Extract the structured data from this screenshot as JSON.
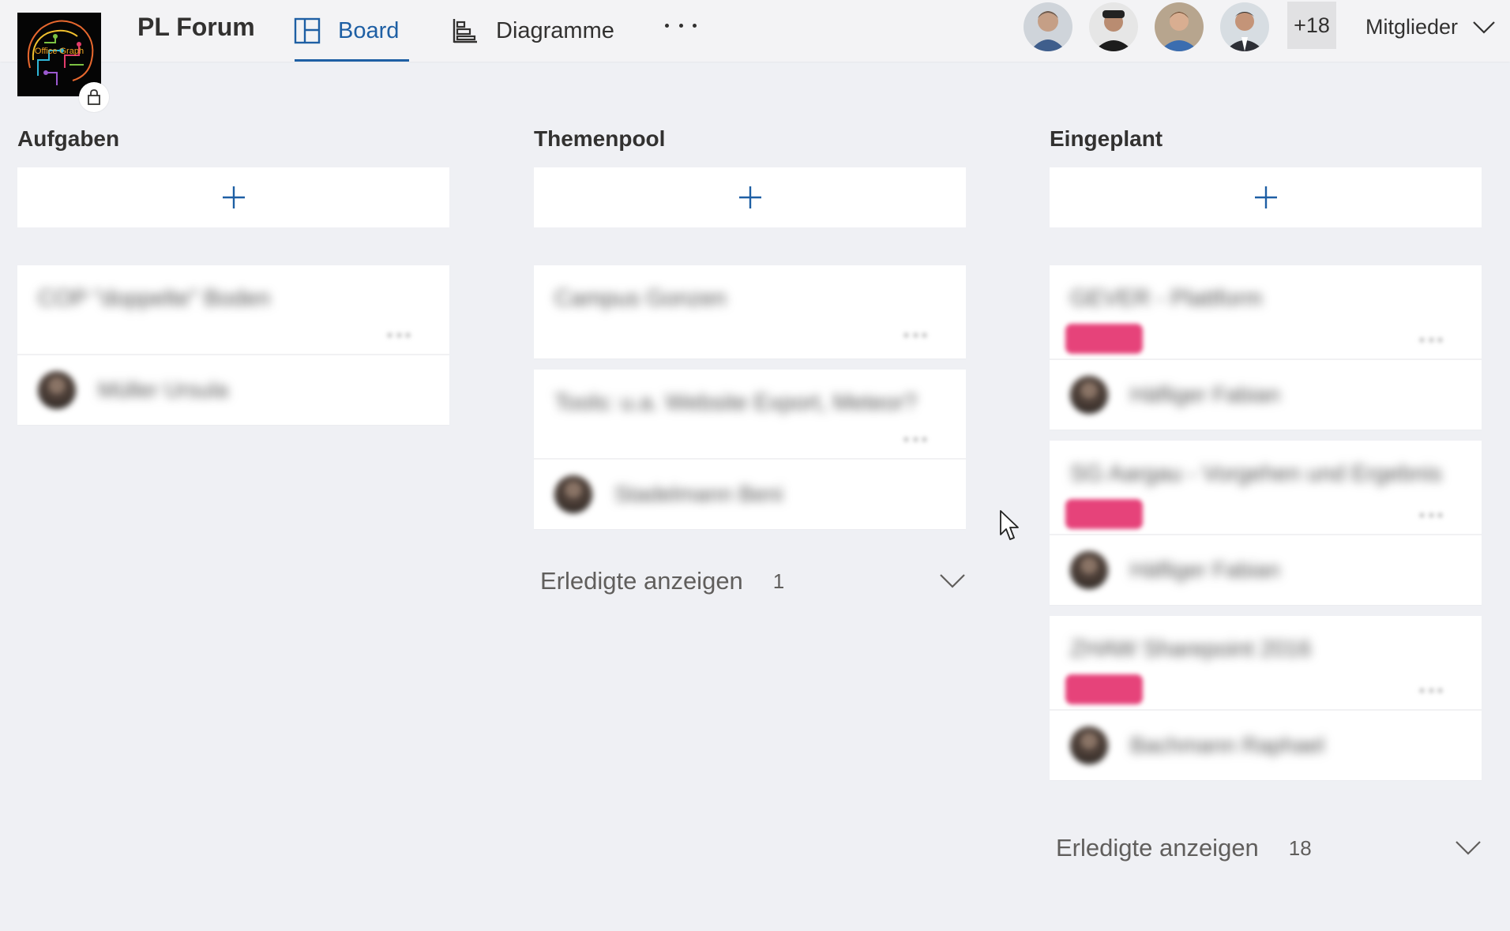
{
  "header": {
    "plan_title": "PL Forum",
    "logo_text": "Office Graph",
    "tabs": [
      {
        "label": "Board",
        "icon": "board-icon",
        "active": true
      },
      {
        "label": "Diagramme",
        "icon": "chart-icon",
        "active": false
      }
    ],
    "more_icon": "ellipsis-icon",
    "members_overflow": "+18",
    "members_label": "Mitglieder",
    "colors": {
      "accent": "#1e5fa4",
      "label_pink": "#e6437a",
      "background": "#eff0f4"
    }
  },
  "columns": [
    {
      "title": "Aufgaben",
      "add_icon": "plus-icon",
      "cards": [
        {
          "title": "COP \"doppelte\" Boden",
          "label": false,
          "assignee": "Müller Ursula"
        }
      ],
      "done": null
    },
    {
      "title": "Themenpool",
      "add_icon": "plus-icon",
      "cards": [
        {
          "title": "Campus Gonzen",
          "label": false,
          "assignee": ""
        },
        {
          "title": "Tools: u.a. Website Export, Meteor?",
          "label": false,
          "assignee": "Stadelmann Beni"
        }
      ],
      "done": {
        "label": "Erledigte anzeigen",
        "count": "1"
      }
    },
    {
      "title": "Eingeplant",
      "add_icon": "plus-icon",
      "cards": [
        {
          "title": "GEVER - Plattform",
          "label": true,
          "assignee": "Häfliger Fabian"
        },
        {
          "title": "SG Aargau - Vorgehen und Ergebnis",
          "label": true,
          "assignee": "Häfliger Fabian"
        },
        {
          "title": "ZHAW Sharepoint 2016",
          "label": true,
          "assignee": "Bachmann Raphael"
        }
      ],
      "done": {
        "label": "Erledigte anzeigen",
        "count": "18"
      }
    }
  ]
}
